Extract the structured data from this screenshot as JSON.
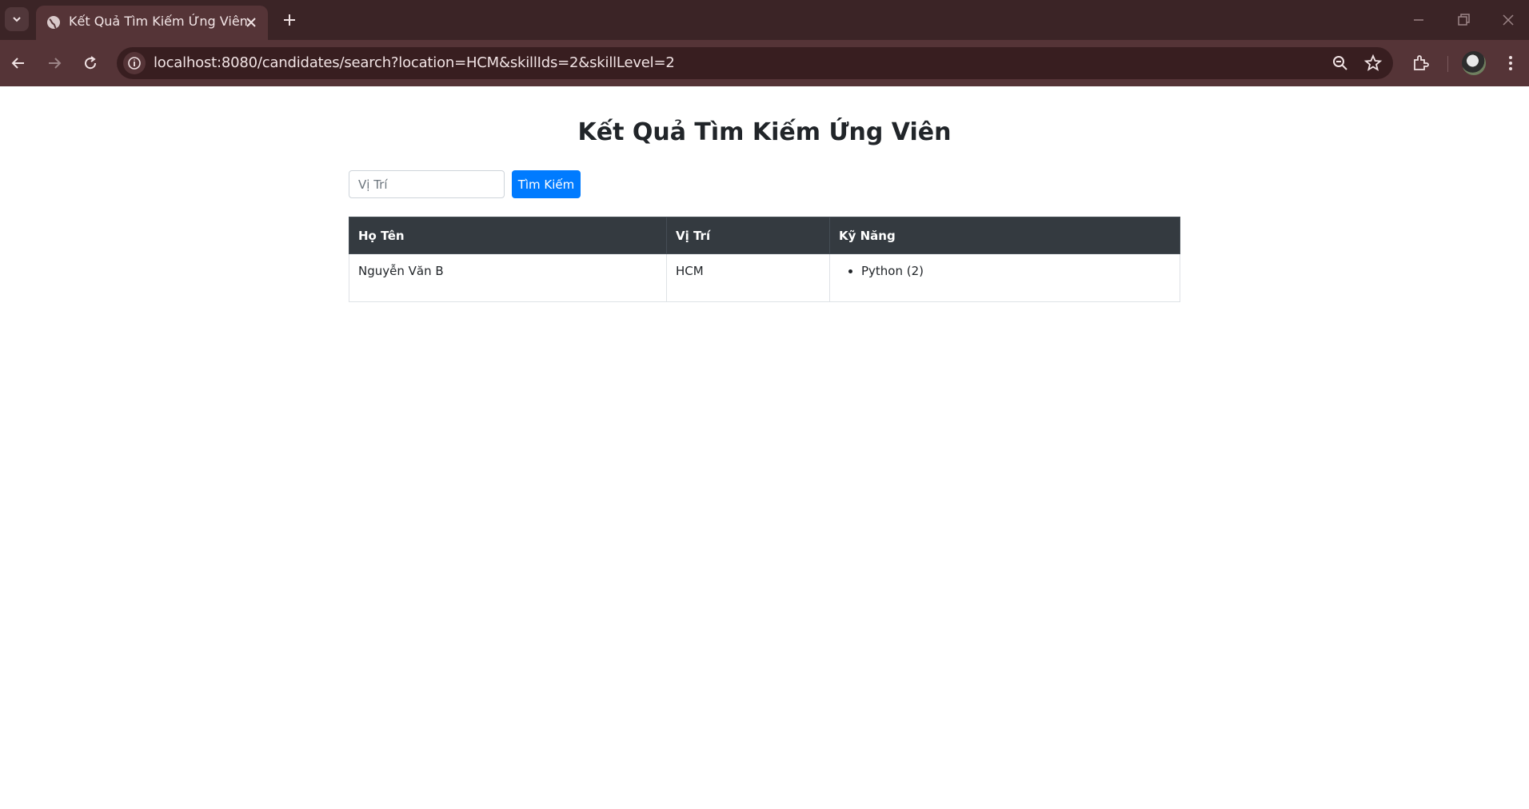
{
  "browser": {
    "tab": {
      "title": "Kết Quả Tìm Kiếm Ứng Viên"
    },
    "url": "localhost:8080/candidates/search?location=HCM&skillIds=2&skillLevel=2"
  },
  "page": {
    "title": "Kết Quả Tìm Kiếm Ứng Viên",
    "search": {
      "placeholder": "Vị Trí",
      "value": "",
      "button_label": "Tìm Kiếm"
    },
    "table": {
      "headers": [
        "Họ Tên",
        "Vị Trí",
        "Kỹ Năng"
      ],
      "rows": [
        {
          "name": "Nguyễn Văn B",
          "location": "HCM",
          "skills": [
            "Python (2)"
          ]
        }
      ]
    }
  },
  "colors": {
    "primary": "#007bff",
    "table_header": "#343a40",
    "chrome_dark": "#3b2426",
    "chrome_toolbar": "#553437"
  },
  "icons": [
    "tab-list-icon",
    "globe-icon",
    "close-icon",
    "plus-icon",
    "minimize-icon",
    "restore-icon",
    "window-close-icon",
    "back-icon",
    "forward-icon",
    "reload-icon",
    "site-info-icon",
    "zoom-icon",
    "star-icon",
    "extensions-icon",
    "menu-icon"
  ]
}
